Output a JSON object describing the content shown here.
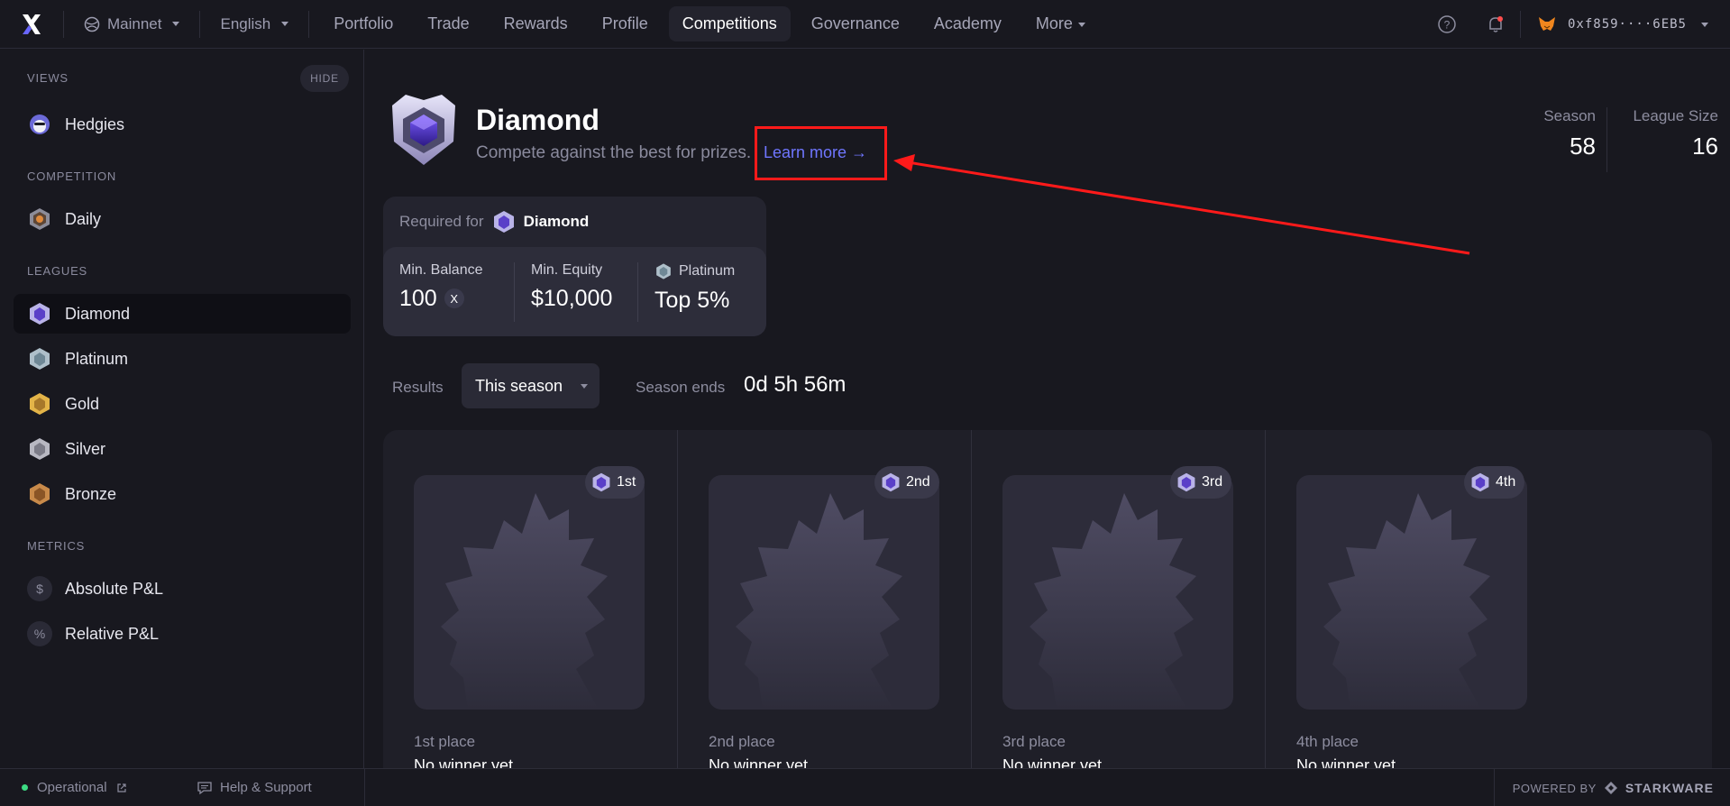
{
  "header": {
    "network": "Mainnet",
    "language": "English",
    "nav": [
      {
        "label": "Portfolio",
        "active": false
      },
      {
        "label": "Trade",
        "active": false
      },
      {
        "label": "Rewards",
        "active": false
      },
      {
        "label": "Profile",
        "active": false
      },
      {
        "label": "Competitions",
        "active": true
      },
      {
        "label": "Governance",
        "active": false
      },
      {
        "label": "Academy",
        "active": false
      },
      {
        "label": "More",
        "active": false
      }
    ],
    "wallet_address": "0xf859····6EB5",
    "icons": [
      "help-icon",
      "notification-bell-icon",
      "metamask-fox-icon"
    ]
  },
  "sidebar": {
    "views_heading": "VIEWS",
    "hide_label": "HIDE",
    "views": [
      {
        "label": "Hedgies",
        "icon": "hedgie-icon"
      }
    ],
    "competition_heading": "COMPETITION",
    "competition": [
      {
        "label": "Daily",
        "icon": "daily-medal-icon"
      }
    ],
    "leagues_heading": "LEAGUES",
    "leagues": [
      {
        "label": "Diamond",
        "icon": "diamond-badge-icon",
        "active": true,
        "color": "#8b7cf6"
      },
      {
        "label": "Platinum",
        "icon": "platinum-badge-icon",
        "active": false,
        "color": "#9fb6c4"
      },
      {
        "label": "Gold",
        "icon": "gold-badge-icon",
        "active": false,
        "color": "#d4a63b"
      },
      {
        "label": "Silver",
        "icon": "silver-badge-icon",
        "active": false,
        "color": "#a7a7b4"
      },
      {
        "label": "Bronze",
        "icon": "bronze-badge-icon",
        "active": false,
        "color": "#b87a3a"
      }
    ],
    "metrics_heading": "METRICS",
    "metrics": [
      {
        "label": "Absolute P&L",
        "icon": "dollar-icon",
        "glyph": "$"
      },
      {
        "label": "Relative P&L",
        "icon": "percent-icon",
        "glyph": "%"
      }
    ]
  },
  "league": {
    "name": "Diamond",
    "subtitle": "Compete against the best for prizes.",
    "learn_more": "Learn more →",
    "season_label": "Season",
    "season_value": "58",
    "league_size_label": "League Size",
    "league_size_value": "16"
  },
  "requirements": {
    "required_for": "Required for",
    "league_name": "Diamond",
    "min_balance_label": "Min. Balance",
    "min_balance_value": "100",
    "min_equity_label": "Min. Equity",
    "min_equity_value": "$10,000",
    "platinum_label": "Platinum",
    "platinum_value": "Top 5%"
  },
  "results": {
    "label": "Results",
    "selected": "This season",
    "season_ends_label": "Season ends",
    "season_ends_value": "0d 5h 56m",
    "places": [
      {
        "pill": "1st",
        "title": "1st place",
        "sub": "No winner yet"
      },
      {
        "pill": "2nd",
        "title": "2nd place",
        "sub": "No winner yet"
      },
      {
        "pill": "3rd",
        "title": "3rd place",
        "sub": "No winner yet"
      },
      {
        "pill": "4th",
        "title": "4th place",
        "sub": "No winner yet"
      }
    ]
  },
  "footer": {
    "status": "Operational",
    "help": "Help & Support",
    "powered_by": "POWERED BY",
    "brand": "STARKWARE"
  },
  "colors": {
    "accent_link": "#6f76ff",
    "highlight": "#ff1a1a",
    "status_green": "#3ddc84"
  }
}
